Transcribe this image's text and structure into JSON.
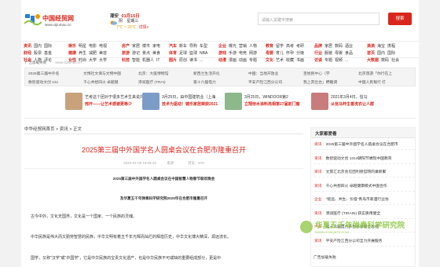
{
  "site": {
    "logo_text": "中国经贸网",
    "logo_url": "www.ctjiumao.cn",
    "weather_city": "潮安",
    "weather_date": "01月15日",
    "weather_cond": "阴",
    "weather_day": "星期三",
    "weather_temp": "7℃ ~ 20℃",
    "weather_detail": "详情»"
  },
  "search": {
    "placeholder": "请输入关键字搜索",
    "button_label": "搜索"
  },
  "nav": [
    {
      "rows": [
        [
          "资讯",
          "国内",
          "国际"
        ],
        [
          "财经",
          "股票",
          "基金"
        ],
        [
          "社会",
          "人物",
          "评论"
        ]
      ]
    },
    {
      "rows": [
        [
          "娱乐",
          "明星",
          "电影",
          "电视"
        ],
        [
          "健康",
          "养生",
          "减肥",
          "美容"
        ],
        [
          "女性",
          "时尚",
          "大学",
          "大学"
        ]
      ]
    },
    {
      "rows": [
        [
          "房产",
          "家居",
          "楼市",
          "家电"
        ],
        [
          "旅游",
          "游记",
          "景点",
          "美食"
        ],
        [
          "科技",
          "智能",
          "机器人",
          "IT"
        ]
      ]
    },
    {
      "rows": [
        [
          "汽车",
          "新车",
          "导购",
          "车型"
        ],
        [
          "体育",
          "足球",
          "篮球",
          "NBA"
        ],
        [
          "图片",
          "原创",
          "读书",
          "..."
        ]
      ]
    },
    {
      "rows": [
        [
          "企业",
          "曝光",
          "营销",
          "人物"
        ],
        [
          "游戏",
          "手游",
          "电竞",
          "网游"
        ],
        [
          "动漫",
          "漫画",
          "动画",
          "专题"
        ]
      ]
    },
    {
      "rows": [
        [
          "教育",
          "留学",
          "高考",
          "考研"
        ],
        [
          "母婴",
          "育儿",
          "怀孕",
          "分娩"
        ],
        [
          "文化",
          "艺术",
          "收藏",
          "书画"
        ]
      ]
    },
    {
      "rows": [
        [
          "品牌",
          "家居",
          "数码",
          "酒业"
        ],
        [
          "行业",
          "服装",
          "母婴",
          "食品"
        ],
        [
          "访谈",
          "专题",
          "视频",
          "..."
        ]
      ]
    },
    {
      "rows": [
        [
          "滴滴",
          "海宝",
          "携程"
        ],
        [
          "首页",
          "国内",
          "国际"
        ],
        [
          "大数据",
          "数码",
          "社会"
        ]
      ]
    }
  ],
  "adline": {
    "label": "广告加载失败",
    "url": "www.ctjiumao.cn"
  },
  "grid": [
    [
      "2025第三届中外名",
      "文博社文保与文物中国",
      "北京：大医博物馆",
      "新西兰生活开化",
      "中国：当地开放业",
      "百姓民中心（学",
      "北京旅游「你行在上"
    ],
    [
      "数智驱动文创 131",
      "千心共想四火 卓越健",
      "添润医疗 (TRAI)",
      "第十六届电力",
      "平安产险江西分公司",
      "我上奔出台」野趣调",
      "中国人民银行 打"
    ]
  ],
  "promo": [
    {
      "t1": "艺考这个团对于很多艺术生来说并",
      "t2": "邢开——让艺术感谢更等少"
    },
    {
      "t1": "3月25日，由中国建筑业（上海",
      "t2": "技术为驱动！镜乐家居荣获2021"
    },
    {
      "t1": "3月25日，WINDOOR第2",
      "t2": "立翔衔木涂料亮相第27届前门窗"
    },
    {
      "t1": "2021年3月4日，信马",
      "t2": "从信马杯生香洗衣让人群"
    }
  ],
  "breadcrumb": "中华经贸网首页 > 资讯 > 正文",
  "article": {
    "title": "2025第三届中外国学名人圆桌会议在合肥市隆重召开",
    "date": "2025-01-09 16:05:23",
    "source": "来源：",
    "views": "浏览：875",
    "bold1": "2025第三届中外国学名人圆桌会议在中国智慧人物春节联欢晚会",
    "bold2": "及华夏五千年弹奏科学研究院2025年在合肥市隆重召开",
    "p1": "古今中外，文化无国界，文化是一个国家、一个民族的灵魂。",
    "p2": "中华民族是伟大而又勤劳智慧的民族，中华文明有着五千年光辉而灿烂的辉煌历史，中华文化博大精深，源远流长。",
    "p3": "国学，又称\"汉学\"或\"中国学\"，它是中华民族的宝贵文化遗产，也是中华民族不可或缺的重要组成部分，更是中"
  },
  "sidebar": {
    "title": "大家都爱看",
    "items": [
      {
        "cat": "资讯",
        "title": "2025第三届中外国学名人圆桌会议在合肥市"
      },
      {
        "cat": "资讯",
        "title": "数智驱动文创 1314朝阳节端现中国教育"
      },
      {
        "cat": "资讯",
        "title": "文旅汇北京会见团利德官院的乘新聚"
      },
      {
        "cat": "资讯",
        "title": "千心共想四火 卓越健康模式中国合作"
      },
      {
        "cat": "企业",
        "title": "\"铭远、共生、价值\"青岛市家酒行业协"
      },
      {
        "cat": "资讯",
        "title": "添润医疗 (TIRAIN) 获实质用健全"
      },
      {
        "cat": "汽车",
        "title": "第十六届电力系列总体健全总统"
      },
      {
        "cat": "资讯",
        "title": "平安产险江西分公司全力开展服务"
      }
    ],
    "ad_label": "广告加载失败"
  },
  "watermark": {
    "text": "华夏五千年弹奏科学研究院",
    "sub": "WWW.HXWQNTZ.COM"
  },
  "colors": {
    "accent": "#d9261c",
    "watermark": "#8cc63f"
  }
}
